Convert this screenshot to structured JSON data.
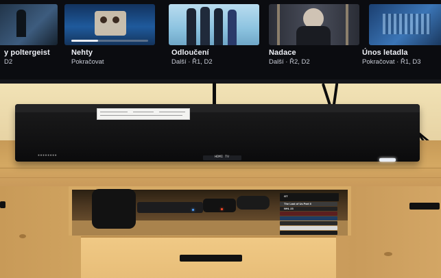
{
  "tv_screen": {
    "tiles": [
      {
        "title": "y poltergeist",
        "subtitle": "D2",
        "thumb_color": "#2f4a66"
      },
      {
        "title": "Nehty",
        "subtitle": "Pokračovat",
        "thumb_color": "#1a4e8a",
        "progress": 0.35
      },
      {
        "title": "Odloučení",
        "subtitle": "Další · Ř1, D2",
        "thumb_color": "#7fb3d4"
      },
      {
        "title": "Nadace",
        "subtitle": "Další · Ř2, D2",
        "thumb_color": "#3a3d47"
      },
      {
        "title": "Únos letadla",
        "subtitle": "Pokračovat · Ř1, D3",
        "thumb_color": "#2e5b8f"
      }
    ]
  },
  "soundbar": {
    "display_text": "HDMI TV",
    "led_color": "#e9eef6"
  },
  "shelf": {
    "game_case_labels": [
      "GT",
      "The Last of Us Part II",
      "NHL 23",
      "",
      "",
      ""
    ]
  }
}
